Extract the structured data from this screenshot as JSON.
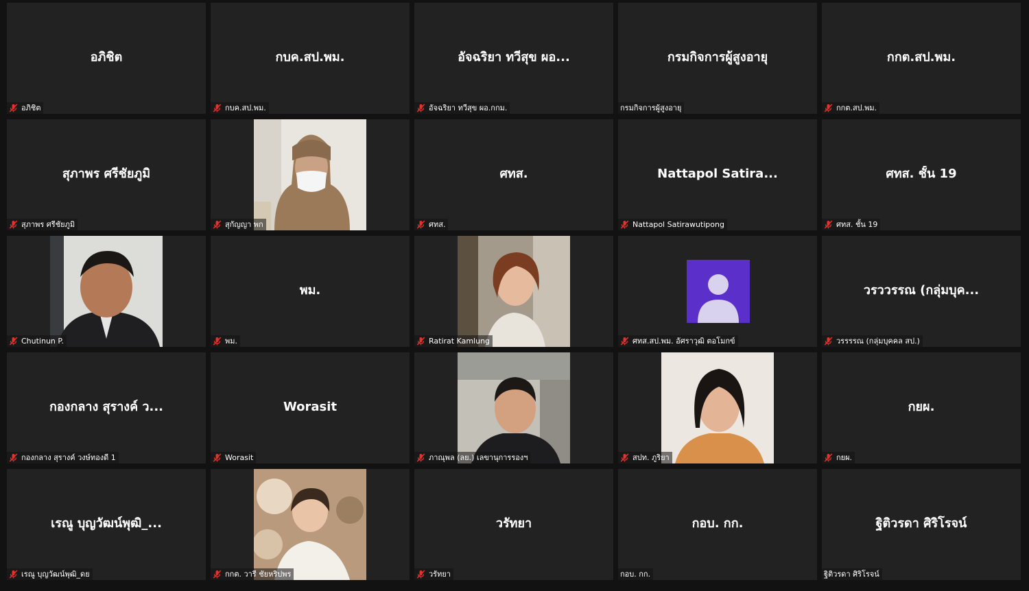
{
  "meeting": {
    "participants": [
      {
        "display_name": "อภิชิต",
        "label": "อภิชิต",
        "muted": true,
        "video": "none"
      },
      {
        "display_name": "กบค.สป.พม.",
        "label": "กบค.สป.พม.",
        "muted": true,
        "video": "none"
      },
      {
        "display_name": "อัจฉริยา ทวีสุข ผอ...",
        "label": "อัจฉริยา ทวีสุข ผอ.กกม.",
        "muted": true,
        "video": "none"
      },
      {
        "display_name": "กรมกิจการผู้สูงอายุ",
        "label": "กรมกิจการผู้สูงอายุ",
        "muted": false,
        "video": "none"
      },
      {
        "display_name": "กกต.สป.พม.",
        "label": "กกต.สป.พม.",
        "muted": true,
        "video": "none"
      },
      {
        "display_name": "สุภาพร ศรีชัยภูมิ",
        "label": "สุภาพร ศรีชัยภูมิ",
        "muted": true,
        "video": "none"
      },
      {
        "display_name": "",
        "label": "สุกัญญา พก",
        "muted": true,
        "video": "woman-hijab-mask"
      },
      {
        "display_name": "ศทส.",
        "label": "ศทส.",
        "muted": true,
        "video": "none"
      },
      {
        "display_name": "Nattapol Satira...",
        "label": "Nattapol Satirawutipong",
        "muted": true,
        "video": "none"
      },
      {
        "display_name": "ศทส. ชั้น 19",
        "label": "ศทส. ชั้น 19",
        "muted": true,
        "video": "none"
      },
      {
        "display_name": "",
        "label": "Chutinun P.",
        "muted": true,
        "video": "man-suit"
      },
      {
        "display_name": "พม.",
        "label": "พม.",
        "muted": true,
        "video": "none"
      },
      {
        "display_name": "",
        "label": "Ratirat Kamlung",
        "muted": true,
        "video": "woman-red-hair"
      },
      {
        "display_name": "",
        "label": "ศทส.สป.พม. อัศราวุฒิ ตอโมกข์",
        "muted": true,
        "video": "avatar-placeholder"
      },
      {
        "display_name": "วรววรรณ (กลุ่มบุค...",
        "label": "วรรรรณ (กลุ่มบุคคล สป.)",
        "muted": true,
        "video": "none"
      },
      {
        "display_name": "กองกลาง สุรางค์ ว...",
        "label": "กองกลาง สุรางค์ วงษ์ทองดี 1",
        "muted": true,
        "video": "none"
      },
      {
        "display_name": "Worasit",
        "label": "Worasit",
        "muted": true,
        "video": "none"
      },
      {
        "display_name": "",
        "label": "ภาณุพล (ลย.) เลขานุการรองฯ",
        "muted": true,
        "video": "man-black-shirt"
      },
      {
        "display_name": "",
        "label": "สปท. ภูริยา",
        "muted": true,
        "video": "woman-orange-top"
      },
      {
        "display_name": "กยผ.",
        "label": "กยผ.",
        "muted": true,
        "video": "none"
      },
      {
        "display_name": "เรณู บุญวัฒน์พุฒิ_...",
        "label": "เรณู บุญวัฒน์พุฒิ_ดย",
        "muted": true,
        "video": "none"
      },
      {
        "display_name": "",
        "label": "กกต. วารี ชัยหริปพร",
        "muted": true,
        "video": "woman-white-dress"
      },
      {
        "display_name": "วรัทยา",
        "label": "วรัทยา",
        "muted": true,
        "video": "none"
      },
      {
        "display_name": "กอบ. กก.",
        "label": "กอบ. กก.",
        "muted": false,
        "video": "none"
      },
      {
        "display_name": "ฐิติวรดา ศิริโรจน์",
        "label": "ฐิติวรดา ศิริโรจน์",
        "muted": false,
        "video": "none"
      }
    ]
  },
  "theme": {
    "background": "#121212",
    "tile_background": "#222222",
    "muted_icon_color": "#e5322d",
    "avatar_color": "#5b2fc9"
  },
  "icons": {
    "muted": "mic-off-icon",
    "avatar": "person-avatar-icon"
  }
}
